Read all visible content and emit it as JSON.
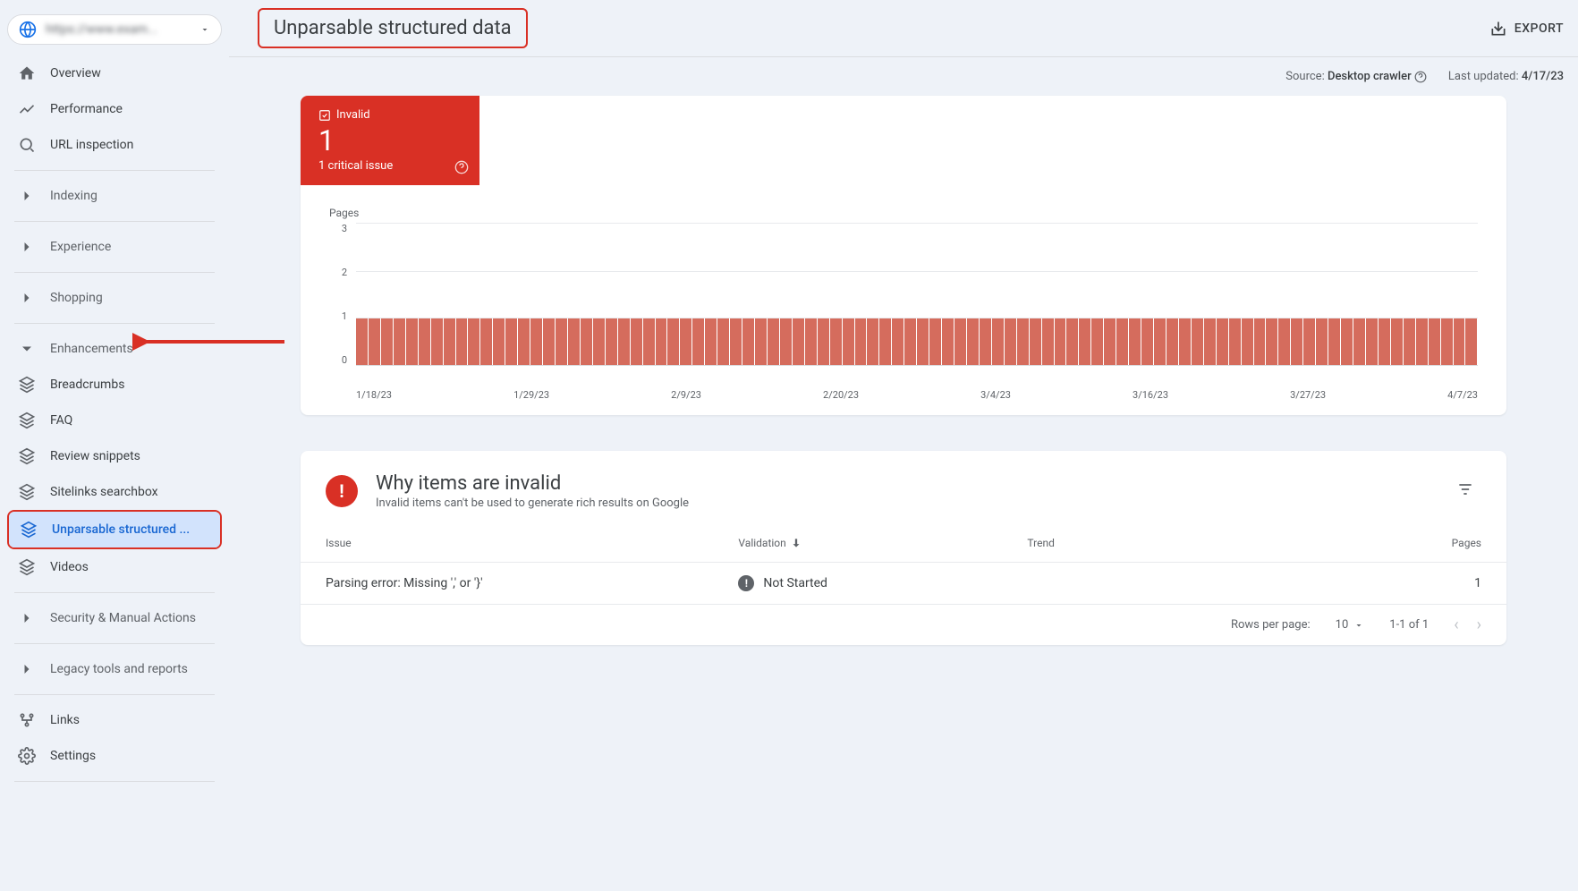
{
  "property_selector": {
    "label": "https://www.exam..."
  },
  "sidebar": {
    "items": {
      "overview": "Overview",
      "performance": "Performance",
      "url_inspection": "URL inspection",
      "indexing": "Indexing",
      "experience": "Experience",
      "shopping": "Shopping",
      "enhancements": "Enhancements",
      "security": "Security & Manual Actions",
      "legacy": "Legacy tools and reports",
      "links": "Links",
      "settings": "Settings"
    },
    "enhancements_items": {
      "breadcrumbs": "Breadcrumbs",
      "faq": "FAQ",
      "review": "Review snippets",
      "sitelinks": "Sitelinks searchbox",
      "unparsable": "Unparsable structured ...",
      "videos": "Videos"
    }
  },
  "header": {
    "title": "Unparsable structured data",
    "export": "EXPORT"
  },
  "meta": {
    "source_label": "Source:",
    "source_value": "Desktop crawler",
    "updated_label": "Last updated:",
    "updated_value": "4/17/23"
  },
  "status": {
    "label": "Invalid",
    "count": "1",
    "subtext": "1 critical issue"
  },
  "chart_data": {
    "type": "bar",
    "ylabel": "Pages",
    "y_ticks": [
      "3",
      "2",
      "1",
      "0"
    ],
    "x_ticks": [
      "1/18/23",
      "1/29/23",
      "2/9/23",
      "2/20/23",
      "3/4/23",
      "3/16/23",
      "3/27/23",
      "4/7/23"
    ],
    "series": [
      {
        "name": "Invalid",
        "value_per_day": 1,
        "days": 90
      }
    ],
    "ylim": [
      0,
      3
    ]
  },
  "issues": {
    "title": "Why items are invalid",
    "subtitle": "Invalid items can't be used to generate rich results on Google",
    "columns": {
      "issue": "Issue",
      "validation": "Validation",
      "trend": "Trend",
      "pages": "Pages"
    },
    "rows": [
      {
        "issue": "Parsing error: Missing ',' or '}'",
        "validation": "Not Started",
        "pages": "1"
      }
    ]
  },
  "pager": {
    "rows_label": "Rows per page:",
    "rows_value": "10",
    "range": "1-1 of 1"
  }
}
